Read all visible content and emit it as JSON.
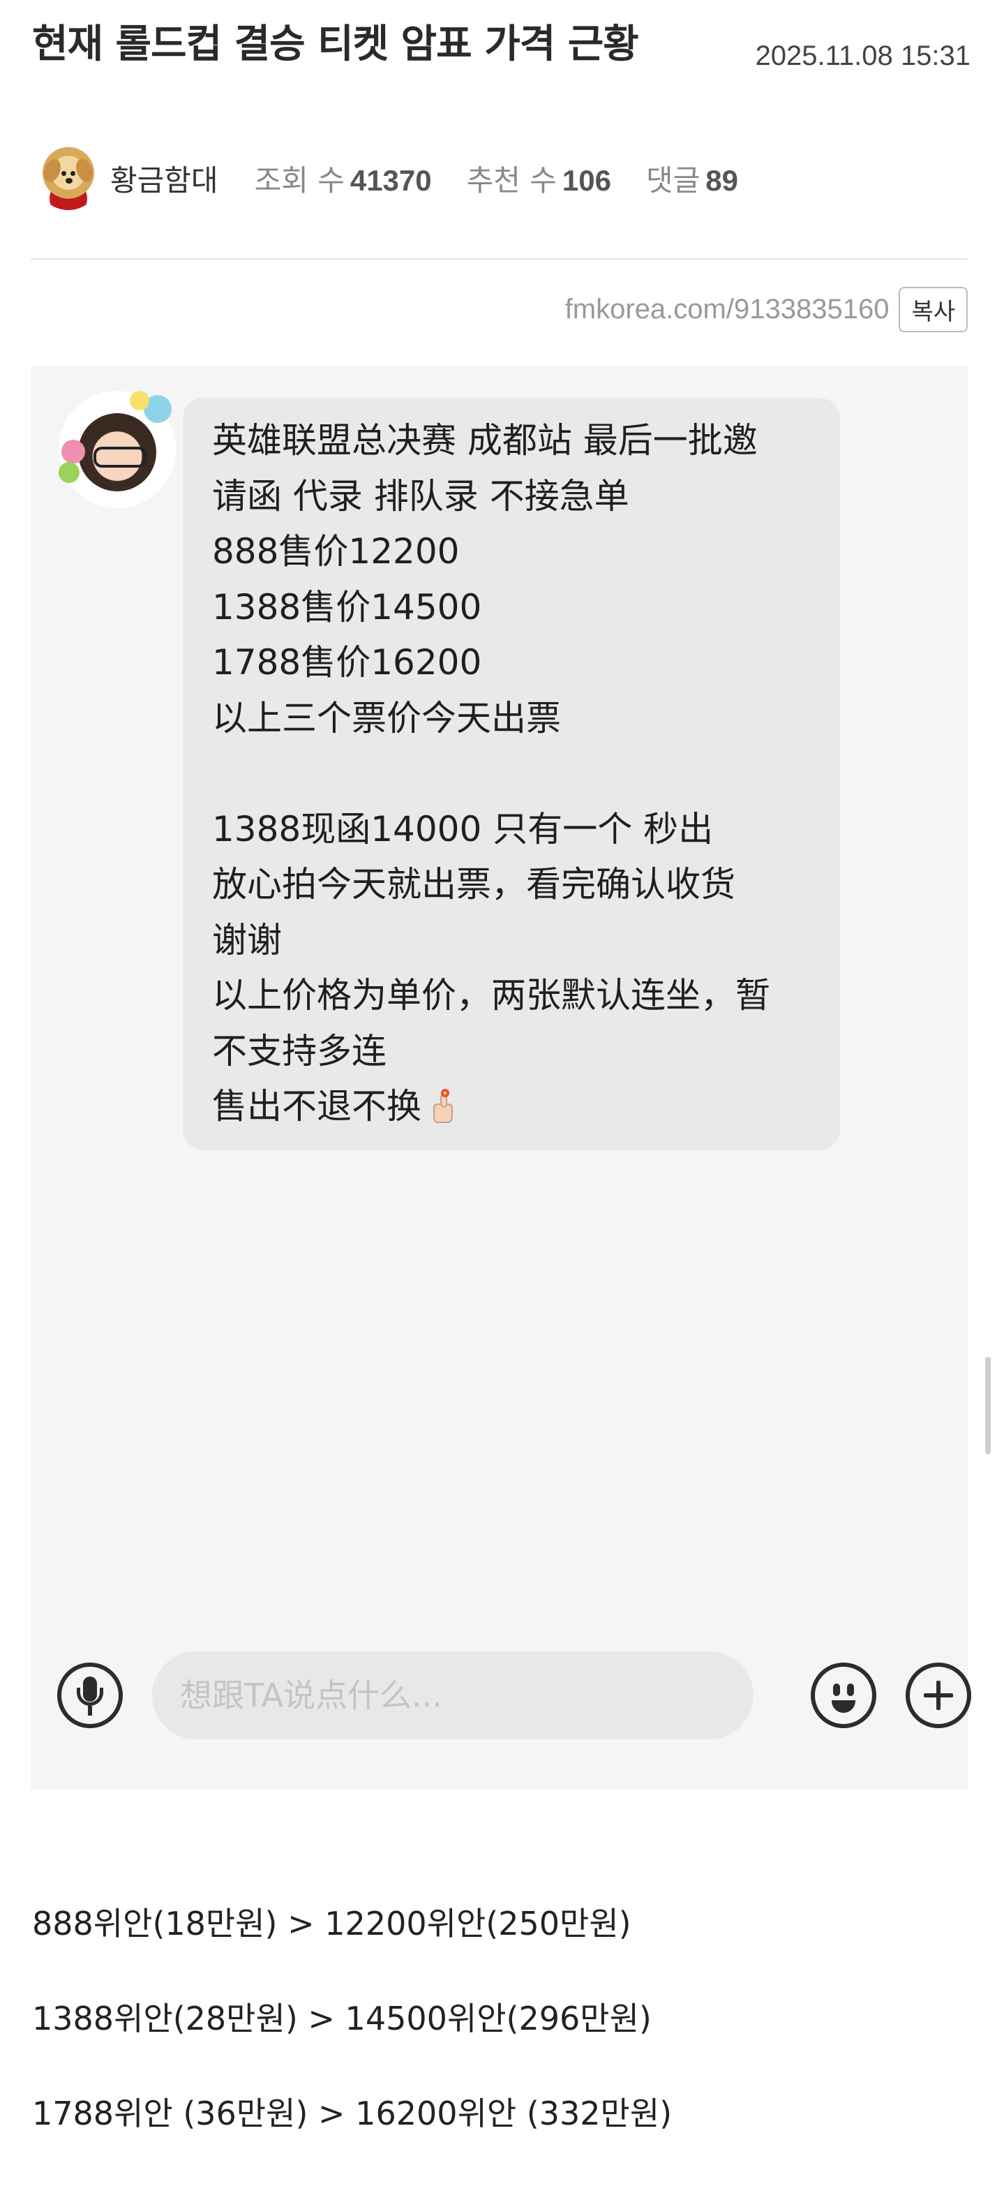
{
  "post": {
    "title": "현재 롤드컵 결승 티켓 암표 가격 근황",
    "date": "2025.11.08 15:31",
    "author": "황금함대",
    "views_label": "조회 수",
    "views": "41370",
    "recommends_label": "추천 수",
    "recommends": "106",
    "comments_label": "댓글",
    "comments": "89",
    "url": "fmkorea.com/9133835160",
    "copy_label": "복사"
  },
  "chat": {
    "message_lines": [
      "英雄联盟总决赛 成都站 最后一批邀",
      "请函 代录 排队录 不接急单",
      "888售价12200",
      "1388售价14500",
      "1788售价16200",
      "以上三个票价今天出票",
      "",
      "1388现函14000 只有一个 秒出",
      "放心拍今天就出票，看完确认收货",
      "谢谢",
      "以上价格为单价，两张默认连坐，暂",
      "不支持多连",
      "售出不退不换"
    ],
    "input_placeholder": "想跟TA说点什么..."
  },
  "prices": [
    "888위안(18만원) > 12200위안(250만원)",
    "1388위안(28만원) > 14500위안(296만원)",
    "1788위안 (36만원) > 16200위안 (332만원)"
  ]
}
